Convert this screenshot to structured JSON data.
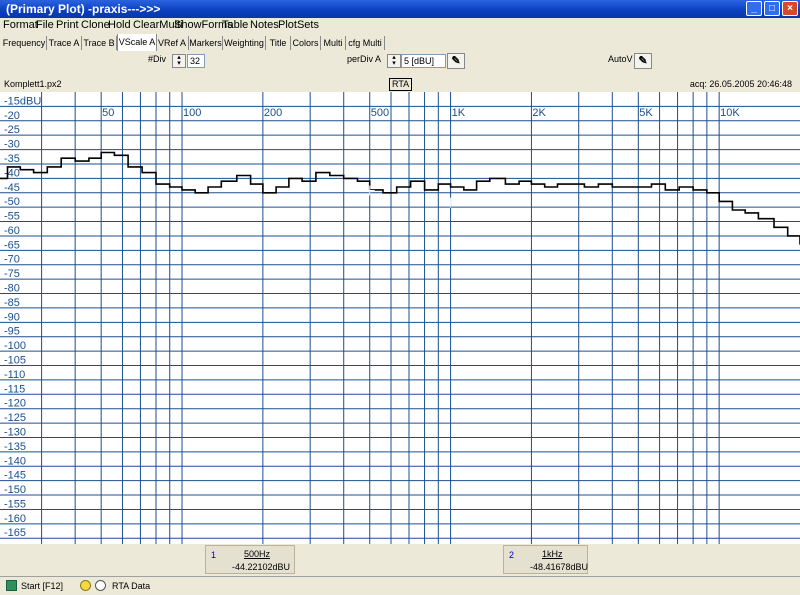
{
  "window": {
    "title": "(Primary Plot) -praxis--->>>",
    "minimize_glyph": "_",
    "maximize_glyph": "□",
    "close_glyph": "×"
  },
  "menu": [
    "Format",
    "File",
    "Print",
    "Clone",
    "Hold",
    "ClearMulti",
    "ShowForms",
    "Table",
    "Notes",
    "PlotSets"
  ],
  "tabs": [
    {
      "label": "Frequency",
      "active": false
    },
    {
      "label": "Trace A",
      "active": false
    },
    {
      "label": "Trace B",
      "active": false
    },
    {
      "label": "VScale A",
      "active": true
    },
    {
      "label": "VRef A",
      "active": false
    },
    {
      "label": "Markers",
      "active": false
    },
    {
      "label": "Weighting",
      "active": false
    },
    {
      "label": "Title",
      "active": false
    },
    {
      "label": "Colors",
      "active": false
    },
    {
      "label": "Multi",
      "active": false
    },
    {
      "label": "cfg Multi",
      "active": false
    }
  ],
  "controls": {
    "ndiv_label": "#Div",
    "ndiv_value": "32",
    "perdiv_label": "perDiv A",
    "perdiv_value": "5 [dBU]",
    "autov_label": "AutoV",
    "pen_glyph": "✎",
    "spin_up": "▴",
    "spin_down": "▾"
  },
  "info": {
    "file": "Komplett1.px2",
    "mode": "RTA",
    "acq": "acq: 26.05.2005 20:46:48"
  },
  "chart_data": {
    "type": "line",
    "x_scale": "log",
    "xlim": [
      21,
      20000
    ],
    "ylim": [
      -167,
      -10
    ],
    "grid": true,
    "x_tick_labels": [
      {
        "x": 50,
        "label": "50"
      },
      {
        "x": 100,
        "label": "100"
      },
      {
        "x": 200,
        "label": "200"
      },
      {
        "x": 500,
        "label": "500"
      },
      {
        "x": 1000,
        "label": "1K"
      },
      {
        "x": 2000,
        "label": "2K"
      },
      {
        "x": 5000,
        "label": "5K"
      },
      {
        "x": 10000,
        "label": "10K"
      }
    ],
    "y_tick_labels": [
      "-15dBU",
      "-20",
      "-25",
      "-30",
      "-35",
      "-40",
      "-45",
      "-50",
      "-55",
      "-60",
      "-65",
      "-70",
      "-75",
      "-80",
      "-85",
      "-90",
      "-95",
      "-100",
      "-105",
      "-110",
      "-115",
      "-120",
      "-125",
      "-130",
      "-135",
      "-140",
      "-145",
      "-150",
      "-155",
      "-160",
      "-165"
    ],
    "y_ticks": [
      -15,
      -20,
      -25,
      -30,
      -35,
      -40,
      -45,
      -50,
      -55,
      -60,
      -65,
      -70,
      -75,
      -80,
      -85,
      -90,
      -95,
      -100,
      -105,
      -110,
      -115,
      -120,
      -125,
      -130,
      -135,
      -140,
      -145,
      -150,
      -155,
      -160,
      -165
    ],
    "series": [
      {
        "type": "step",
        "color": "#000000",
        "x": [
          21,
          22.4,
          25,
          28,
          31.5,
          35.5,
          40,
          45,
          50,
          56,
          63,
          71,
          80,
          90,
          100,
          112,
          125,
          140,
          160,
          180,
          200,
          224,
          250,
          280,
          315,
          355,
          400,
          450,
          500,
          560,
          630,
          710,
          800,
          900,
          1000,
          1120,
          1250,
          1400,
          1600,
          1800,
          2000,
          2240,
          2500,
          2800,
          3150,
          3550,
          4000,
          4500,
          5000,
          5600,
          6300,
          7100,
          8000,
          9000,
          10000,
          11200,
          12500,
          14000,
          16000,
          18000,
          20000
        ],
        "y": [
          -40,
          -36,
          -37,
          -38,
          -36,
          -33,
          -34,
          -33,
          -31,
          -32,
          -36,
          -38,
          -42,
          -43,
          -44,
          -45,
          -43,
          -41,
          -39,
          -42,
          -45,
          -43,
          -40,
          -41,
          -38,
          -39,
          -40,
          -41,
          -44,
          -45,
          -43,
          -41,
          -44,
          -42,
          -43,
          -44,
          -41,
          -40,
          -42,
          -41,
          -42,
          -43,
          -42,
          -42,
          -43,
          -42,
          -43,
          -43,
          -43,
          -42,
          -44,
          -43,
          -44,
          -45,
          -48,
          -51,
          -52,
          -54,
          -57,
          -60,
          -63
        ]
      }
    ]
  },
  "markers": [
    {
      "num": "1",
      "freq": "500Hz",
      "value": "-44.22102dBU"
    },
    {
      "num": "2",
      "freq": "1kHz",
      "value": "-48.41678dBU"
    }
  ],
  "status": {
    "start": "Start [F12]",
    "rta": "RTA Data"
  },
  "colors": {
    "grid": "#1a4f8f",
    "axis_text": "#1a4f8f",
    "title_bar": "#0a3fbf"
  }
}
